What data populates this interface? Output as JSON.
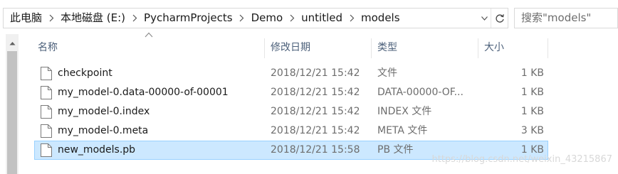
{
  "breadcrumb": {
    "items": [
      "此电脑",
      "本地磁盘 (E:)",
      "PycharmProjects",
      "Demo",
      "untitled",
      "models"
    ]
  },
  "search": {
    "placeholder": "搜索\"models\""
  },
  "columns": {
    "name": "名称",
    "date": "修改日期",
    "type": "类型",
    "size": "大小"
  },
  "sort": {
    "column": "name",
    "direction": "ascending"
  },
  "files": [
    {
      "name": "checkpoint",
      "date": "2018/12/21 15:42",
      "type": "文件",
      "size": "1 KB",
      "selected": false
    },
    {
      "name": "my_model-0.data-00000-of-00001",
      "date": "2018/12/21 15:42",
      "type": "DATA-00000-OF...",
      "size": "1 KB",
      "selected": false
    },
    {
      "name": "my_model-0.index",
      "date": "2018/12/21 15:42",
      "type": "INDEX 文件",
      "size": "1 KB",
      "selected": false
    },
    {
      "name": "my_model-0.meta",
      "date": "2018/12/21 15:42",
      "type": "META 文件",
      "size": "3 KB",
      "selected": false
    },
    {
      "name": "new_models.pb",
      "date": "2018/12/21 15:58",
      "type": "PB 文件",
      "size": "1 KB",
      "selected": true
    }
  ],
  "icons": {
    "separator": "chevron-right-icon",
    "address_dropdown": "chevron-down-icon",
    "refresh": "refresh-icon",
    "file": "file-icon",
    "scroll_up": "scroll-up-arrow-icon",
    "sort": "sort-ascending-icon"
  },
  "colors": {
    "selection_fill": "#cce8ff",
    "selection_border": "#99d1ff",
    "header_text": "#4c607a"
  },
  "watermark": "https://blog.csdn.net/weixin_43215867"
}
